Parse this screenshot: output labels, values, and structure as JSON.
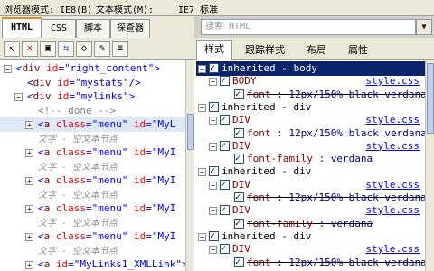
{
  "modebar": {
    "browser_mode": "浏览器模式: IE8(B)",
    "doc_mode": "文本模式(M):",
    "doc_mode_value": "IE7 标准"
  },
  "tabs": [
    "HTML",
    "CSS",
    "脚本",
    "探查器"
  ],
  "search": {
    "placeholder": "搜索 HTML"
  },
  "right_tabs": [
    "样式",
    "跟踪样式",
    "布局",
    "属性"
  ],
  "tree": [
    {
      "indent": 1,
      "toggle": "−",
      "html": "<div id=\"right_content\">",
      "tag": "div",
      "attr": "id",
      "val": "right_content"
    },
    {
      "indent": 2,
      "toggle": "",
      "tag": "div",
      "attr": "id",
      "val": "mystats",
      "selfclose": true
    },
    {
      "indent": 2,
      "toggle": "−",
      "tag": "div",
      "attr": "id",
      "val": "mylinks"
    },
    {
      "indent": 3,
      "type": "comment",
      "text": "<!-- done -->"
    },
    {
      "indent": 3,
      "toggle": "+",
      "tag": "a",
      "attr": "class",
      "val": "menu",
      "attr2": "id",
      "val2": "MyL",
      "selected": true
    },
    {
      "indent": 3,
      "type": "text",
      "text": "文字 - 空文本节点"
    },
    {
      "indent": 3,
      "toggle": "+",
      "tag": "a",
      "attr": "class",
      "val": "menu",
      "attr2": "id",
      "val2": "MyI"
    },
    {
      "indent": 3,
      "type": "text",
      "text": "文字 - 空文本节点"
    },
    {
      "indent": 3,
      "toggle": "+",
      "tag": "a",
      "attr": "class",
      "val": "menu",
      "attr2": "id",
      "val2": "MyI"
    },
    {
      "indent": 3,
      "type": "text",
      "text": "文字 - 空文本节点"
    },
    {
      "indent": 3,
      "toggle": "+",
      "tag": "a",
      "attr": "class",
      "val": "menu",
      "attr2": "id",
      "val2": "MyI"
    },
    {
      "indent": 3,
      "type": "text",
      "text": "文字 - 空文本节点"
    },
    {
      "indent": 3,
      "toggle": "+",
      "tag": "a",
      "attr": "class",
      "val": "menu",
      "attr2": "id",
      "val2": "MyI"
    },
    {
      "indent": 3,
      "type": "text",
      "text": "文字 - 空文本节点"
    },
    {
      "indent": 3,
      "toggle": "+",
      "tag": "a",
      "attr": "id",
      "val": "MyLinks1_XMLLink"
    }
  ],
  "styles": [
    {
      "type": "section",
      "text": "inherited - body",
      "highlight": true
    },
    {
      "type": "rule",
      "selector": "BODY",
      "source": "style.css"
    },
    {
      "type": "prop",
      "prop": "font",
      "value": "12px/150% black verdana",
      "strike": true
    },
    {
      "type": "section",
      "text": "inherited - div"
    },
    {
      "type": "rule",
      "selector": "DIV",
      "source": "style.css"
    },
    {
      "type": "prop",
      "prop": "font",
      "value": "12px/150% black verdana"
    },
    {
      "type": "rule",
      "selector": "DIV",
      "source": "style.css"
    },
    {
      "type": "prop",
      "prop": "font-family",
      "value": "verdana"
    },
    {
      "type": "section",
      "text": "inherited - div"
    },
    {
      "type": "rule",
      "selector": "DIV",
      "source": "style.css"
    },
    {
      "type": "prop",
      "prop": "font",
      "value": "12px/150% black verdana",
      "strike": true
    },
    {
      "type": "rule",
      "selector": "DIV",
      "source": "style.css"
    },
    {
      "type": "prop",
      "prop": "font-family",
      "value": "verdana",
      "strike": true
    },
    {
      "type": "section",
      "text": "inherited - div"
    },
    {
      "type": "rule",
      "selector": "DIV",
      "source": "style.css"
    },
    {
      "type": "prop",
      "prop": "font",
      "value": "12px/150% black verdana",
      "strike": true
    }
  ]
}
